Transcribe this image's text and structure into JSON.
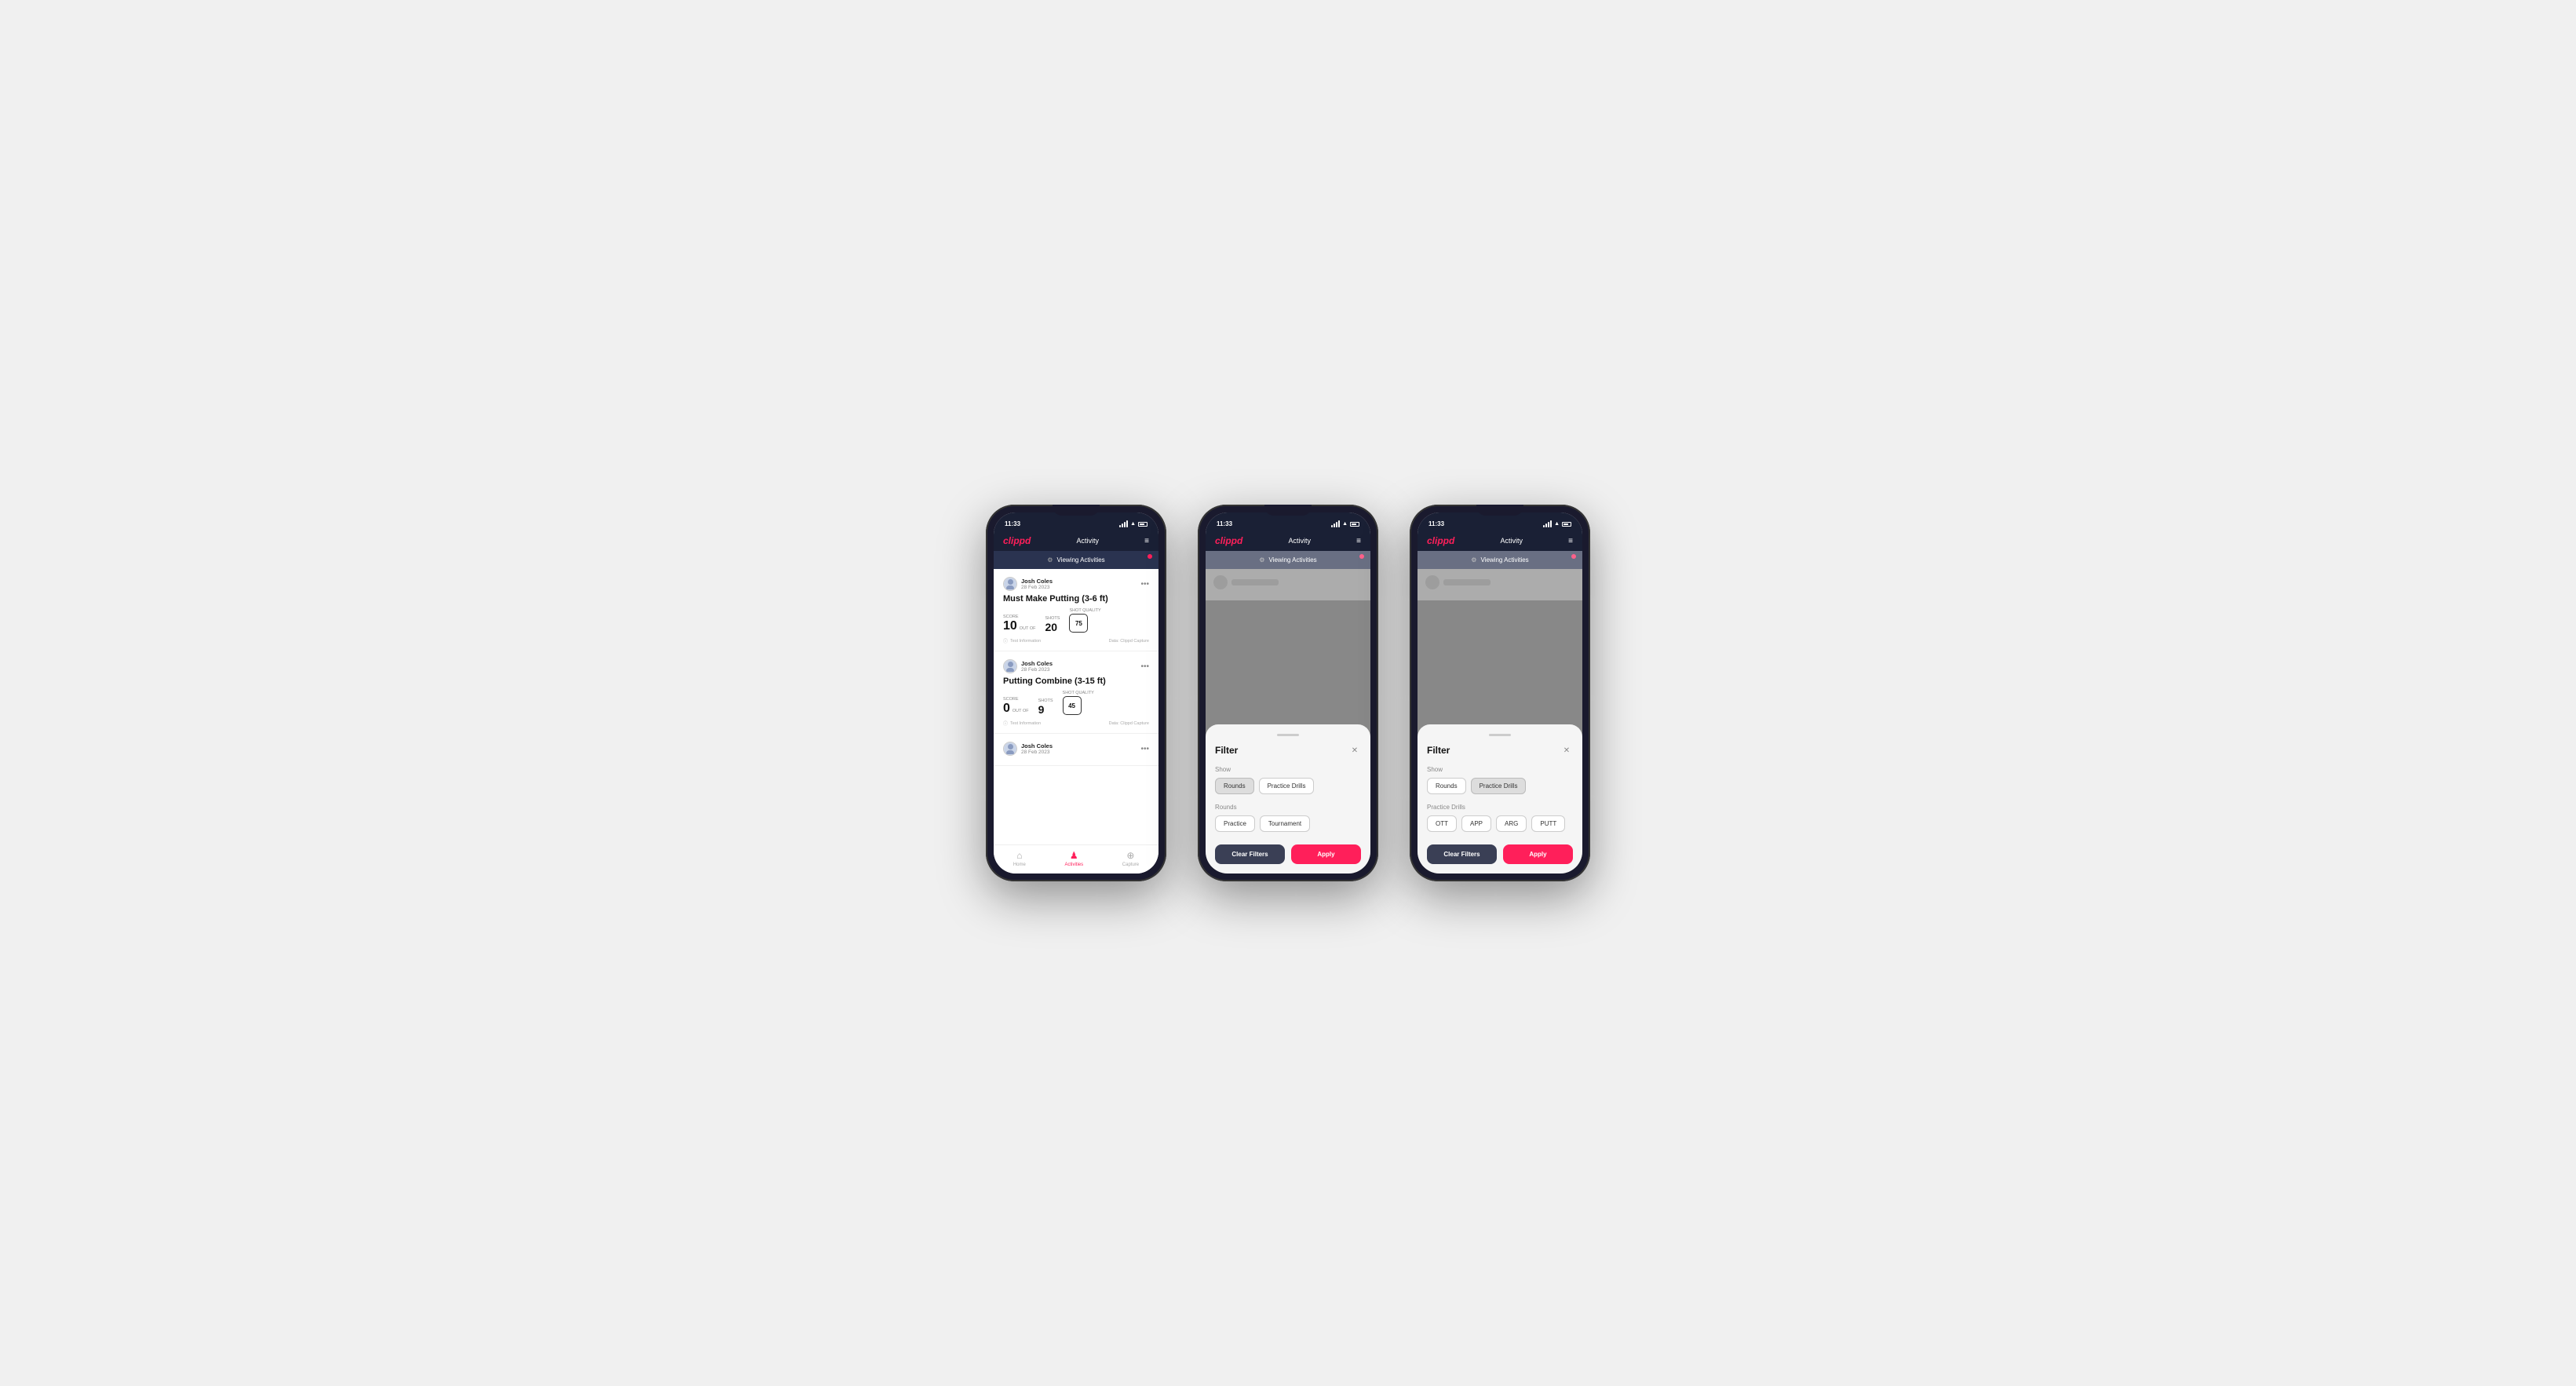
{
  "app": {
    "logo": "clippd",
    "header_title": "Activity",
    "status_time": "11:33"
  },
  "banner": {
    "text": "Viewing Activities",
    "filter_icon": "⚙"
  },
  "activities": [
    {
      "user_name": "Josh Coles",
      "user_date": "28 Feb 2023",
      "title": "Must Make Putting (3-6 ft)",
      "score_label": "Score",
      "score_value": "10",
      "out_of_label": "OUT OF",
      "shots_label": "Shots",
      "shots_value": "20",
      "shot_quality_label": "Shot Quality",
      "shot_quality_value": "75",
      "footer_left": "Test Information",
      "footer_right": "Data: Clippd Capture"
    },
    {
      "user_name": "Josh Coles",
      "user_date": "28 Feb 2023",
      "title": "Putting Combine (3-15 ft)",
      "score_label": "Score",
      "score_value": "0",
      "out_of_label": "OUT OF",
      "shots_label": "Shots",
      "shots_value": "9",
      "shot_quality_label": "Shot Quality",
      "shot_quality_value": "45",
      "footer_left": "Test Information",
      "footer_right": "Data: Clippd Capture"
    },
    {
      "user_name": "Josh Coles",
      "user_date": "28 Feb 2023",
      "title": "",
      "score_value": "",
      "shots_value": "",
      "shot_quality_value": ""
    }
  ],
  "nav": {
    "items": [
      {
        "label": "Home",
        "icon": "🏠",
        "active": false
      },
      {
        "label": "Activities",
        "icon": "👤",
        "active": true
      },
      {
        "label": "Capture",
        "icon": "⊕",
        "active": false
      }
    ]
  },
  "filter_modal_1": {
    "title": "Filter",
    "show_label": "Show",
    "buttons_show": [
      {
        "label": "Rounds",
        "active": true
      },
      {
        "label": "Practice Drills",
        "active": false
      }
    ],
    "rounds_label": "Rounds",
    "buttons_rounds": [
      {
        "label": "Practice",
        "active": false
      },
      {
        "label": "Tournament",
        "active": false
      }
    ],
    "clear_filters": "Clear Filters",
    "apply": "Apply"
  },
  "filter_modal_2": {
    "title": "Filter",
    "show_label": "Show",
    "buttons_show": [
      {
        "label": "Rounds",
        "active": false
      },
      {
        "label": "Practice Drills",
        "active": true
      }
    ],
    "practice_drills_label": "Practice Drills",
    "buttons_drills": [
      {
        "label": "OTT",
        "active": false
      },
      {
        "label": "APP",
        "active": false
      },
      {
        "label": "ARG",
        "active": false
      },
      {
        "label": "PUTT",
        "active": false
      }
    ],
    "clear_filters": "Clear Filters",
    "apply": "Apply"
  }
}
